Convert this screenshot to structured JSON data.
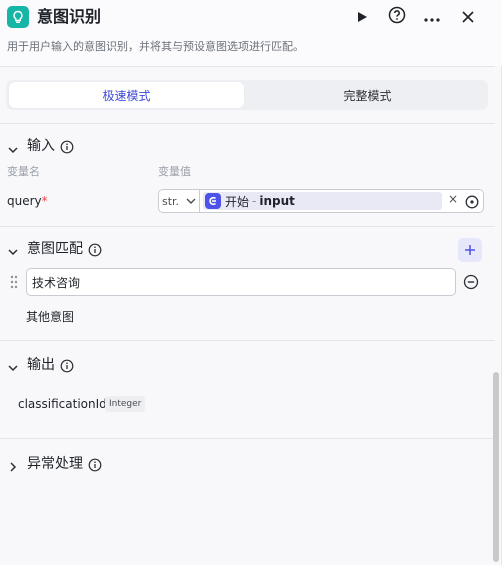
{
  "node": {
    "title": "意图识别",
    "description": "用于用户输入的意图识别，并将其与预设意图选项进行匹配。"
  },
  "modes": [
    "极速模式",
    "完整模式"
  ],
  "input_section": {
    "title": "输入",
    "col_name": "变量名",
    "col_value": "变量值",
    "param_name": "query",
    "required_mark": "*",
    "type": "str.",
    "ref_node": "开始",
    "ref_sep": "-",
    "ref_field": "input",
    "clear": "×"
  },
  "intent_section": {
    "title": "意图匹配",
    "intents": [
      "技术咨询"
    ],
    "other": "其他意图"
  },
  "output_section": {
    "title": "输出",
    "var_name": "classificationId",
    "var_type": "Integer"
  },
  "exception_section": {
    "title": "异常处理"
  },
  "colors": {
    "accent": "#4d53e8",
    "brand": "#16b6a6"
  }
}
